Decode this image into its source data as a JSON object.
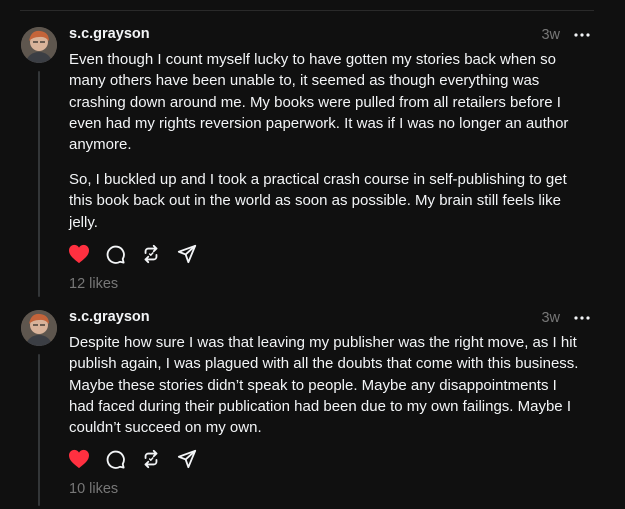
{
  "colors": {
    "background": "#101010",
    "text_primary": "#f3f5f7",
    "text_secondary": "#777777",
    "like_active": "#ff3040",
    "thread_line": "#333638"
  },
  "posts": [
    {
      "username": "s.c.grayson",
      "time": "3w",
      "paragraphs": [
        "Even though I count myself lucky to have gotten my stories back when so many others have been unable to, it seemed as though everything was crashing down around me. My books were pulled from all retailers before I even had my rights reversion paperwork. It was if I was no longer an author anymore.",
        "So, I buckled up and I took a practical crash course in self-publishing to get this book back out in the world as soon as possible. My brain still feels like jelly."
      ],
      "liked": true,
      "likes": "12 likes",
      "action_icons": [
        "heart-icon",
        "comment-icon",
        "repost-icon",
        "share-icon"
      ]
    },
    {
      "username": "s.c.grayson",
      "time": "3w",
      "paragraphs": [
        "Despite how sure I was that leaving my publisher was the right move, as I hit publish again, I was plagued with all the doubts that come with this business. Maybe these stories didn’t speak to people. Maybe any disappointments I had faced during their publication had been due to my own failings. Maybe I couldn’t succeed on my own."
      ],
      "liked": true,
      "likes": "10 likes",
      "action_icons": [
        "heart-icon",
        "comment-icon",
        "repost-icon",
        "share-icon"
      ]
    }
  ]
}
